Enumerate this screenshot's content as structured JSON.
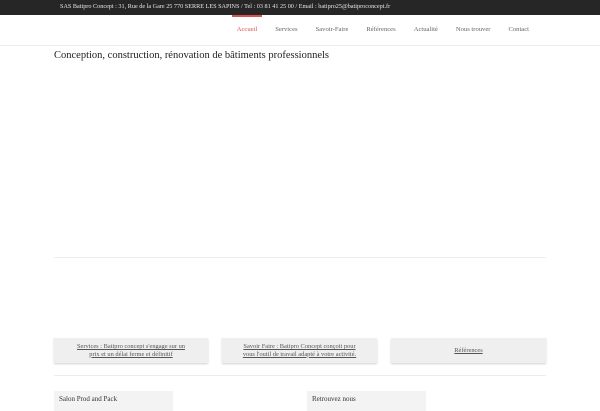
{
  "topbar": {
    "info": "SAS Batipro Concept : 31, Rue de la Gare 25 770 SERRE LES SAPINS / Tel : 03 81 41 25 00 / Email : batipro25@batiproconcept.fr"
  },
  "nav": {
    "items": [
      {
        "label": "Accueil",
        "active": true
      },
      {
        "label": "Services"
      },
      {
        "label": "Savoir-Faire"
      },
      {
        "label": "Références"
      },
      {
        "label": "Actualité"
      },
      {
        "label": "Nous trouver"
      },
      {
        "label": "Contact"
      }
    ],
    "accent_color": "#d9534f"
  },
  "main": {
    "title": "Conception, construction, rénovation de bâtiments professionnels"
  },
  "cards": [
    {
      "line1": "Services : Batipro concept s'engage sur un",
      "line2": "prix et un délai ferme et définitif"
    },
    {
      "line1": "Savoir Faire : Batipro Concept conçoit pour",
      "line2": "vous l'outil de travail adapté à votre activité."
    },
    {
      "line1": "Références"
    }
  ],
  "bottom": {
    "left_title": "Salon Prod and Pack",
    "right_title": "Retrouvez nous"
  }
}
